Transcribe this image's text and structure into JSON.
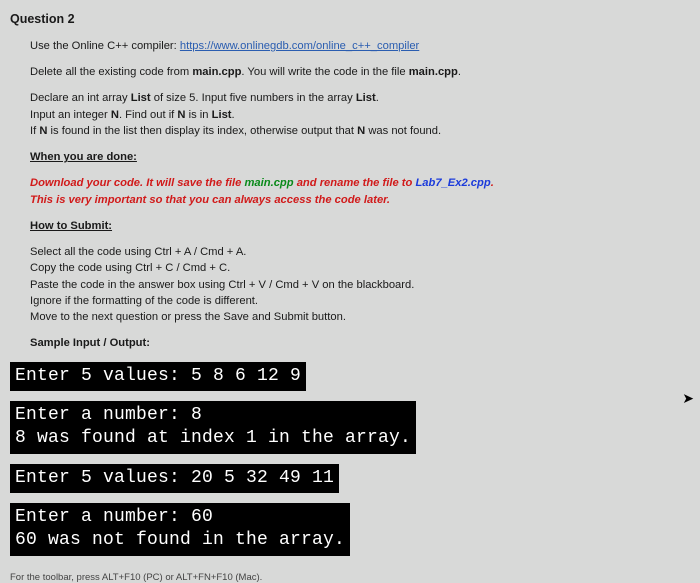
{
  "question_title": "Question 2",
  "intro": {
    "prefix": "Use the Online C++ compiler: ",
    "link_text": "https://www.onlinegdb.com/online_c++_compiler",
    "delete_line_a": "Delete all the existing code from ",
    "delete_file1": "main.cpp",
    "delete_line_b": ". You will write the code in the file ",
    "delete_file2": "main.cpp",
    "delete_line_c": "."
  },
  "task": {
    "l1a": "Declare an int array ",
    "l1b": "List",
    "l1c": " of size 5. Input five numbers in the array ",
    "l1d": "List",
    "l1e": ".",
    "l2a": "Input an integer ",
    "l2b": "N",
    "l2c": ". Find out if ",
    "l2d": "N",
    "l2e": " is in ",
    "l2f": "List",
    "l2g": ".",
    "l3a": "If ",
    "l3b": "N",
    "l3c": " is found in the list then display its index, otherwise output that ",
    "l3d": "N",
    "l3e": " was not found."
  },
  "done_header": "When you are done:",
  "download": {
    "a": "Download your code. It will save the file ",
    "file1": "main.cpp",
    "b": " and rename the file to ",
    "file2": "Lab7_Ex2.cpp",
    "c": ".",
    "important": "This is very important so that you can always access the code later."
  },
  "submit_header": "How to Submit:",
  "submit_lines": {
    "s1": "Select all the code using Ctrl + A / Cmd + A.",
    "s2": "Copy the code using Ctrl + C / Cmd + C.",
    "s3": "Paste the code in the answer box using Ctrl + V / Cmd + V on the blackboard.",
    "s4": "Ignore if the formatting of the code is different.",
    "s5": "Move to the next question or press the Save and Submit button."
  },
  "sample_header": "Sample Input / Output:",
  "terminals": {
    "t1": "Enter 5 values: 5 8 6 12 9",
    "t2a": "Enter a number: 8",
    "t2b": "8 was found at index 1 in the array.",
    "t3": "Enter 5 values: 20 5 32 49 11",
    "t4a": "Enter a number: 60",
    "t4b": "60 was not found in the array."
  },
  "footer": "For the toolbar, press ALT+F10 (PC) or ALT+FN+F10 (Mac)."
}
